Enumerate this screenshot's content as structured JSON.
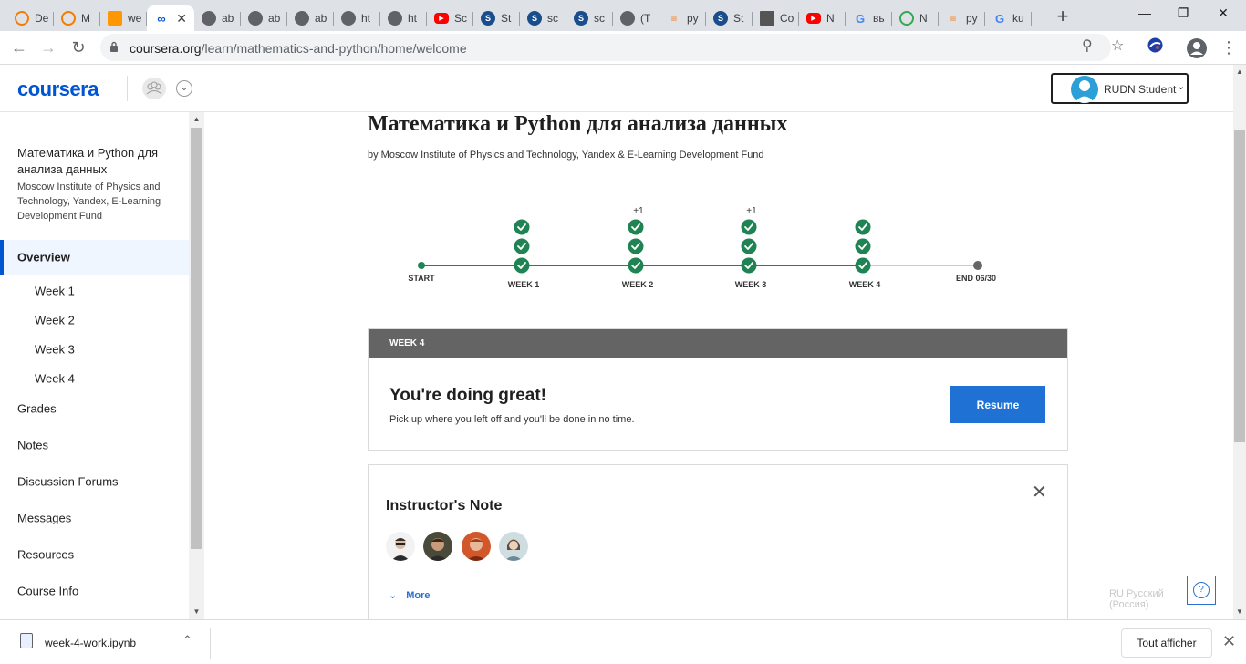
{
  "browser": {
    "tabs": [
      {
        "label": "De",
        "icon": "orange-ring-icon",
        "color": "#f57c00"
      },
      {
        "label": "M",
        "icon": "orange-ring-icon",
        "color": "#f57c00"
      },
      {
        "label": "we",
        "icon": "book-icon",
        "color": "#ff9800"
      },
      {
        "label": "",
        "icon": "coursera-icon",
        "color": "#0056d2",
        "active": true
      },
      {
        "label": "ab",
        "icon": "globe-icon",
        "color": "#5f6368"
      },
      {
        "label": "ab",
        "icon": "globe-icon",
        "color": "#5f6368"
      },
      {
        "label": "ab",
        "icon": "globe-icon",
        "color": "#5f6368"
      },
      {
        "label": "ht",
        "icon": "globe-icon",
        "color": "#5f6368"
      },
      {
        "label": "ht",
        "icon": "globe-icon",
        "color": "#5f6368"
      },
      {
        "label": "Sc",
        "icon": "youtube-icon",
        "color": "#ff0000"
      },
      {
        "label": "St",
        "icon": "s-icon",
        "color": "#1a4d8c"
      },
      {
        "label": "sc",
        "icon": "s-icon",
        "color": "#1a4d8c"
      },
      {
        "label": "sc",
        "icon": "s-icon",
        "color": "#1a4d8c"
      },
      {
        "label": "(T",
        "icon": "globe-icon",
        "color": "#5f6368"
      },
      {
        "label": "py",
        "icon": "stackoverflow-icon",
        "color": "#f48024"
      },
      {
        "label": "St",
        "icon": "s-icon",
        "color": "#1a4d8c"
      },
      {
        "label": "Co",
        "icon": "image-icon",
        "color": "#555555"
      },
      {
        "label": "N",
        "icon": "youtube-icon",
        "color": "#ff0000"
      },
      {
        "label": "вь",
        "icon": "google-icon",
        "color": "#4285f4"
      },
      {
        "label": "N",
        "icon": "ring-icon",
        "color": "#34a853"
      },
      {
        "label": "py",
        "icon": "stackoverflow-icon",
        "color": "#f48024"
      },
      {
        "label": "ku",
        "icon": "google-icon",
        "color": "#4285f4"
      }
    ],
    "url_host": "coursera.org",
    "url_path": "/learn/mathematics-and-python/home/welcome"
  },
  "header": {
    "logo": "coursera",
    "user_name": "RUDN Student"
  },
  "sidebar": {
    "course_title": "Математика и Python для анализа данных",
    "course_org": "Moscow Institute of Physics and Technology, Yandex, E-Learning Development Fund",
    "items": [
      {
        "label": "Overview",
        "active": true
      },
      {
        "label": "Week 1",
        "sub": true
      },
      {
        "label": "Week 2",
        "sub": true
      },
      {
        "label": "Week 3",
        "sub": true
      },
      {
        "label": "Week 4",
        "sub": true
      },
      {
        "label": "Grades"
      },
      {
        "label": "Notes"
      },
      {
        "label": "Discussion Forums"
      },
      {
        "label": "Messages"
      },
      {
        "label": "Resources"
      },
      {
        "label": "Course Info"
      }
    ]
  },
  "main": {
    "course_heading": "Математика и Python для анализа данных",
    "course_by": "by Moscow Institute of Physics and Technology, Yandex & E-Learning Development Fund",
    "timeline": {
      "start_label": "START",
      "end_label": "END 06/30",
      "weeks": [
        {
          "label": "WEEK 1",
          "checks": 3,
          "extra": ""
        },
        {
          "label": "WEEK 2",
          "checks": 3,
          "extra": "+1"
        },
        {
          "label": "WEEK 3",
          "checks": 3,
          "extra": "+1"
        },
        {
          "label": "WEEK 4",
          "checks": 3,
          "extra": ""
        }
      ],
      "colors": {
        "done": "#1f8354",
        "pending": "#cccccc",
        "end": "#666666"
      }
    },
    "week_card": {
      "label": "WEEK 4",
      "title": "You're doing great!",
      "subtitle": "Pick up where you left off and you'll be done in no time.",
      "button": "Resume"
    },
    "note_card": {
      "title": "Instructor's Note",
      "more": "More",
      "avatars": [
        "instructor-1",
        "instructor-2",
        "instructor-3",
        "instructor-4"
      ]
    },
    "language": "RU Русский (Россия)",
    "help": "?"
  },
  "downloads": {
    "file": "week-4-work.ipynb",
    "show_all": "Tout afficher"
  }
}
